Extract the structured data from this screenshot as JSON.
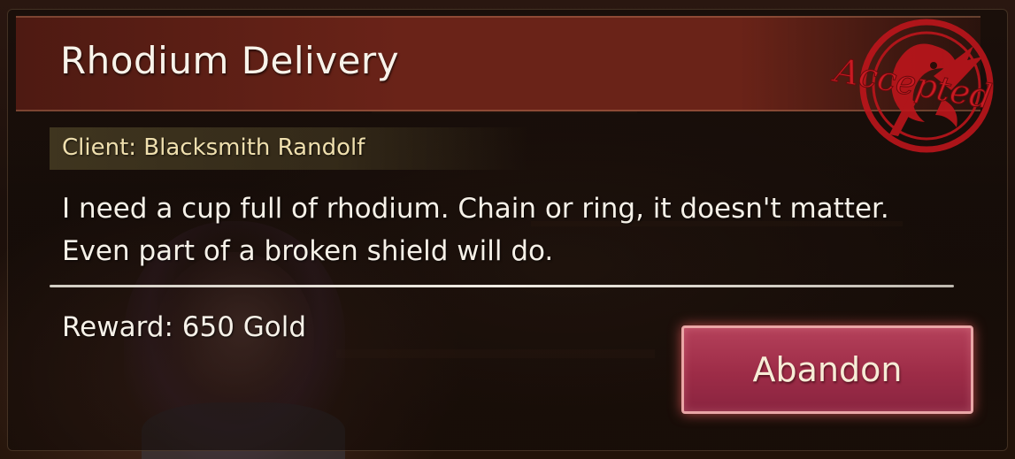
{
  "quest": {
    "title": "Rhodium Delivery",
    "client": "Client: Blacksmith Randolf",
    "description": "I need a cup full of rhodium. Chain or ring, it doesn't matter. Even part of a broken shield will do.",
    "reward": "Reward: 650 Gold",
    "status_stamp": "Accepted",
    "abandon_label": "Abandon"
  },
  "colors": {
    "title_bar": "#6a2318",
    "client_text": "#efdfae",
    "stamp_red": "#c0151c",
    "button_fill": "#9d2c47",
    "button_border": "#e9a6a6"
  },
  "icons": {
    "stamp": "dragon-seal-icon"
  }
}
